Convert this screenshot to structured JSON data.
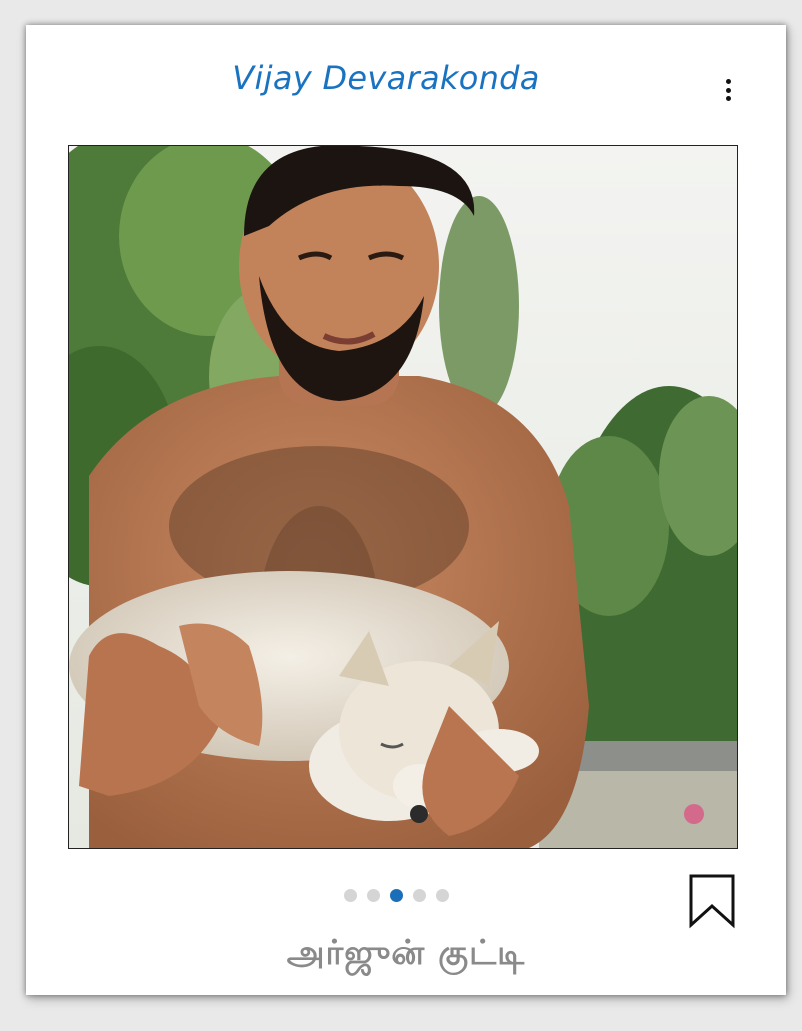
{
  "post": {
    "author_name": "Vijay Devarakonda",
    "menu_icon": "more-vertical-icon",
    "image_alt": "Man holding a white husky puppy outdoors",
    "carousel": {
      "total": 5,
      "active": 3
    },
    "bookmark_icon": "bookmark-outline-icon",
    "caption": "அர்ஜுன் குட்டி"
  },
  "colors": {
    "accent": "#1a73c0",
    "dot_active": "#1a6fb8",
    "dot_inactive": "#d5d5d5",
    "caption": "#8a8a8a"
  }
}
